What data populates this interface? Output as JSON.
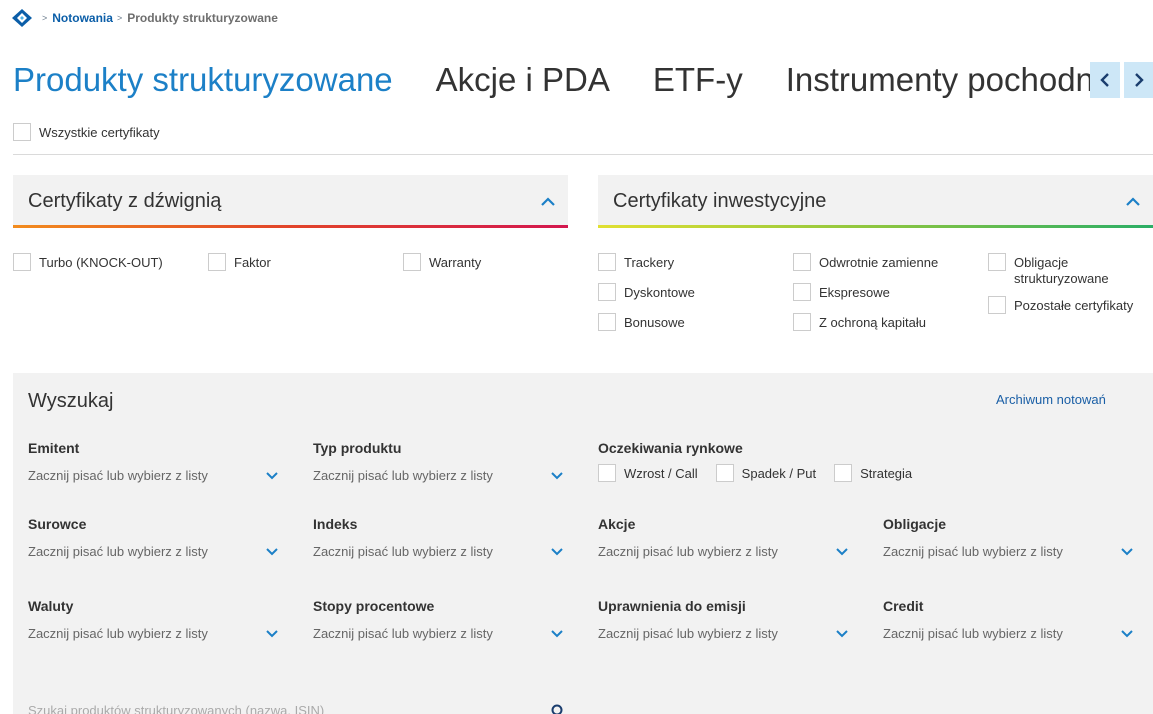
{
  "breadcrumb": {
    "items": [
      "Notowania",
      "Produkty strukturyzowane"
    ]
  },
  "tabs": [
    "Produkty strukturyzowane",
    "Akcje i PDA",
    "ETF-y",
    "Instrumenty pochodne"
  ],
  "all_certificates": "Wszystkie certyfikaty",
  "leverage_panel": {
    "title": "Certyfikaty z dźwignią",
    "options": [
      "Turbo (KNOCK-OUT)",
      "Faktor",
      "Warranty"
    ]
  },
  "investment_panel": {
    "title": "Certyfikaty inwestycyjne",
    "options": [
      "Trackery",
      "Dyskontowe",
      "Bonusowe",
      "Odwrotnie zamienne",
      "Ekspresowe",
      "Z ochroną kapitału",
      "Obligacje strukturyzowane",
      "Pozostałe certyfikaty"
    ]
  },
  "search": {
    "title": "Wyszukaj",
    "archive_link": "Archiwum notowań",
    "placeholder": "Zacznij pisać lub wybierz z listy",
    "fields": [
      "Emitent",
      "Typ produktu",
      "Surowce",
      "Indeks",
      "Akcje",
      "Obligacje",
      "Waluty",
      "Stopy procentowe",
      "Uprawnienia do emisji",
      "Credit"
    ],
    "market_expectations": {
      "label": "Oczekiwania rynkowe",
      "options": [
        "Wzrost / Call",
        "Spadek / Put",
        "Strategia"
      ]
    },
    "product_search_placeholder": "Szukaj produktów strukturyzowanych (nazwa, ISIN)"
  },
  "colors": {
    "accent": "#1c80c7",
    "link": "#0b5ea8",
    "leverage_gradient": [
      "#f28c1e",
      "#d3174f"
    ],
    "investment_gradient": [
      "#e1e031",
      "#2bae66"
    ]
  }
}
